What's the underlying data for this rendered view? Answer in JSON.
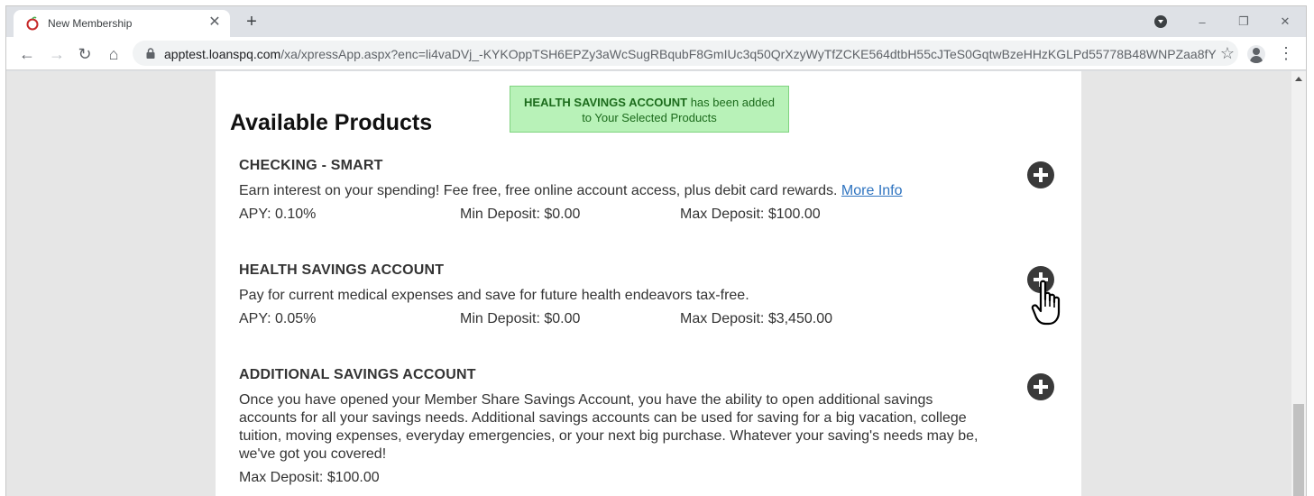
{
  "browser": {
    "tab_title": "New Membership",
    "tab_close": "✕",
    "new_tab": "+",
    "url_host": "apptest.loanspq.com",
    "url_path": "/xa/xpressApp.aspx?enc=li4vaDVj_-KYKOppTSH6EPZy3aWcSugRBqubF8GmIUc3q50QrXzyWyTfZCKE564dtbH55cJTeS0GqtwBzeHHzKGLPd55778B48WNPZaa8fY",
    "window_controls": [
      "–",
      "❐",
      "✕"
    ]
  },
  "page": {
    "heading": "Available Products",
    "toast": {
      "strong": "HEALTH SAVINGS ACCOUNT",
      "line1_rest": " has been added",
      "line2": "to Your Selected Products"
    },
    "products": [
      {
        "title": "CHECKING - SMART",
        "description": "Earn interest on your spending! Fee free, free online account access, plus debit card rewards. ",
        "link": "More Info",
        "apy": "APY: 0.10%",
        "min_deposit": "Min Deposit: $0.00",
        "max_deposit": "Max Deposit: $100.00"
      },
      {
        "title": "HEALTH SAVINGS ACCOUNT",
        "description": "Pay for current medical expenses and save for future health endeavors tax-free.",
        "apy": "APY: 0.05%",
        "min_deposit": "Min Deposit: $0.00",
        "max_deposit": "Max Deposit: $3,450.00"
      },
      {
        "title": "ADDITIONAL SAVINGS ACCOUNT",
        "description": "Once you have opened your Member Share Savings Account, you have the ability to open additional savings accounts for all your savings needs. Additional savings accounts can be used for saving for a big vacation, college tuition, moving expenses, everyday emergencies, or your next big purchase. Whatever your saving's needs may be, we've got you covered!",
        "max_deposit": "Max Deposit: $100.00"
      }
    ]
  },
  "colors": {
    "toast_bg": "#b8f2b8",
    "link": "#2f74c0",
    "add_button": "#3a3a3a"
  }
}
